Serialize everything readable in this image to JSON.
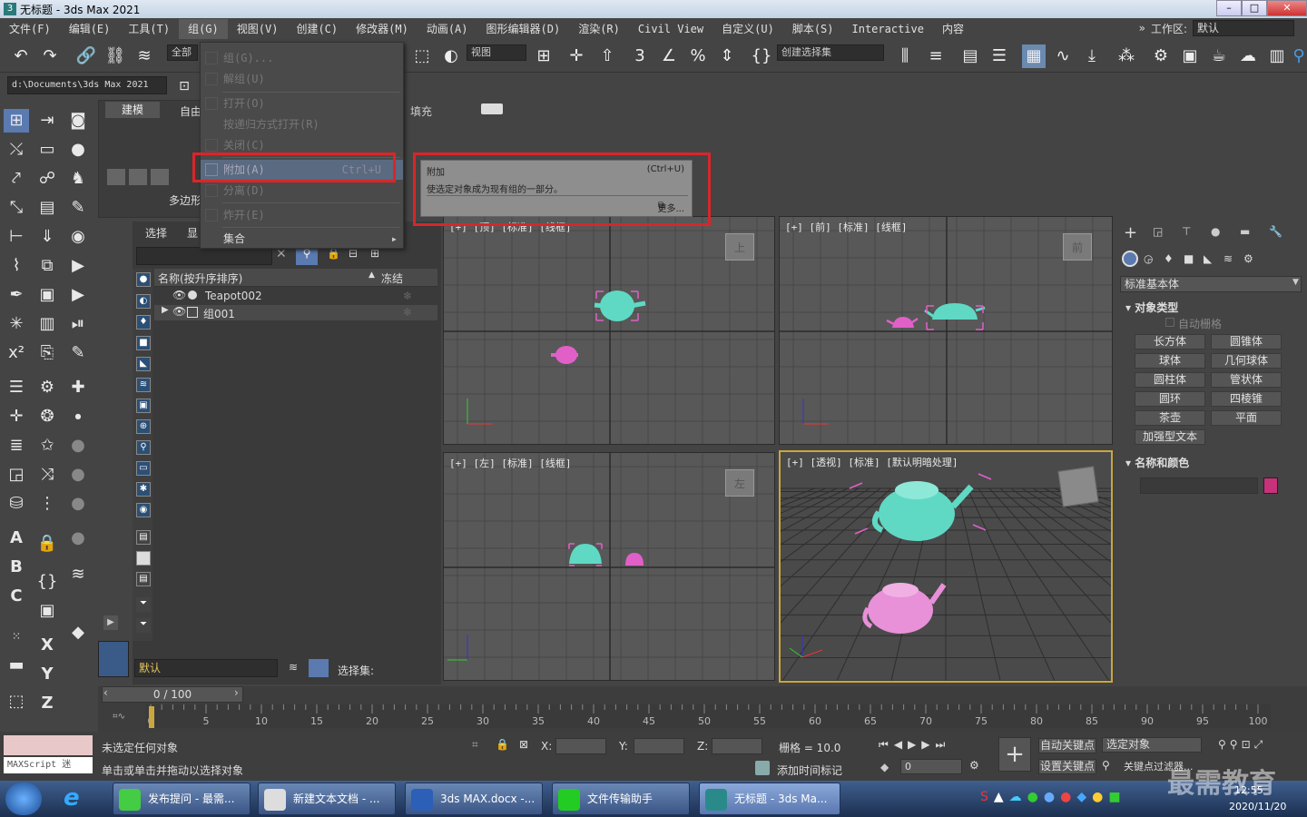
{
  "window": {
    "title": "无标题 - 3ds Max 2021"
  },
  "menu": [
    "文件(F)",
    "编辑(E)",
    "工具(T)",
    "组(G)",
    "视图(V)",
    "创建(C)",
    "修改器(M)",
    "动画(A)",
    "图形编辑器(D)",
    "渲染(R)",
    "Civil View",
    "自定义(U)",
    "脚本(S)",
    "Interactive",
    "内容"
  ],
  "workspace": {
    "label": "工作区:",
    "value": "默认"
  },
  "toolbar": {
    "filter": "全部",
    "view": "视图",
    "selection_set": "创建选择集"
  },
  "path": "d:\\Documents\\3ds Max 2021",
  "ribbon": {
    "tab": "建模",
    "tab2": "自由",
    "label": "多边形"
  },
  "group_menu": {
    "items": [
      {
        "label": "组(G)...",
        "shortcut": ""
      },
      {
        "label": "解组(U)",
        "shortcut": ""
      },
      {
        "label": "打开(O)",
        "shortcut": ""
      },
      {
        "label": "按递归方式打开(R)",
        "shortcut": ""
      },
      {
        "label": "关闭(C)",
        "shortcut": ""
      },
      {
        "label": "附加(A)",
        "shortcut": "Ctrl+U"
      },
      {
        "label": "分离(D)",
        "shortcut": ""
      },
      {
        "label": "炸开(E)",
        "shortcut": ""
      },
      {
        "label": "集合",
        "shortcut": ""
      }
    ]
  },
  "tooltip": {
    "title": "附加",
    "shortcut": "(Ctrl+U)",
    "desc": "使选定对象成为现有组的一部分。",
    "more": "更多..."
  },
  "fill_label": "填充",
  "scene_explorer": {
    "tabs": [
      "选择",
      "显示"
    ],
    "col_name": "名称(按升序排序)",
    "col_freeze": "冻结",
    "rows": [
      "Teapot002",
      "组001"
    ],
    "layer": "默认",
    "selset_label": "选择集:"
  },
  "viewports": {
    "top": "[+] [顶] [标准] [线框]",
    "front": "[+] [前] [标准] [线框]",
    "left": "[+] [左] [标准] [线框]",
    "persp": "[+] [透视] [标准] [默认明暗处理]",
    "cube_top": "上",
    "cube_front": "前",
    "cube_left": "左"
  },
  "command_panel": {
    "category": "标准基本体",
    "section_object_type": "对象类型",
    "autogrid": "自动栅格",
    "buttons": [
      "长方体",
      "圆锥体",
      "球体",
      "几何球体",
      "圆柱体",
      "管状体",
      "圆环",
      "四棱锥",
      "茶壶",
      "平面",
      "加强型文本"
    ],
    "section_name_color": "名称和颜色",
    "object_color": "#c8327a"
  },
  "timeline": {
    "frame": "0 / 100",
    "ticks": [
      "0",
      "5",
      "10",
      "15",
      "20",
      "25",
      "30",
      "35",
      "40",
      "45",
      "50",
      "55",
      "60",
      "65",
      "70",
      "75",
      "80",
      "85",
      "90",
      "95",
      "100"
    ]
  },
  "status": {
    "maxscript": "MAXScript 迷",
    "line1": "未选定任何对象",
    "line2": "单击或单击并拖动以选择对象",
    "x": "X:",
    "y": "Y:",
    "z": "Z:",
    "grid": "栅格 = 10.0",
    "add_time_tag": "添加时间标记",
    "auto_key": "自动关键点",
    "selected_object": "选定对象",
    "set_key": "设置关键点",
    "key_filter": "关键点过滤器...",
    "frame_field": "0"
  },
  "taskbar": {
    "items": [
      "发布提问 - 最需...",
      "新建文本文档 - ...",
      "3ds MAX.docx -...",
      "文件传输助手",
      "无标题 - 3ds Ma..."
    ],
    "time": "12:55",
    "date": "2020/11/20",
    "watermark": "最需教育"
  },
  "colors": {
    "teapot_cyan": "#5fd9c4",
    "teapot_pink": "#e060c8",
    "highlight_red": "#d8262a",
    "active_viewport": "#c9a640"
  }
}
